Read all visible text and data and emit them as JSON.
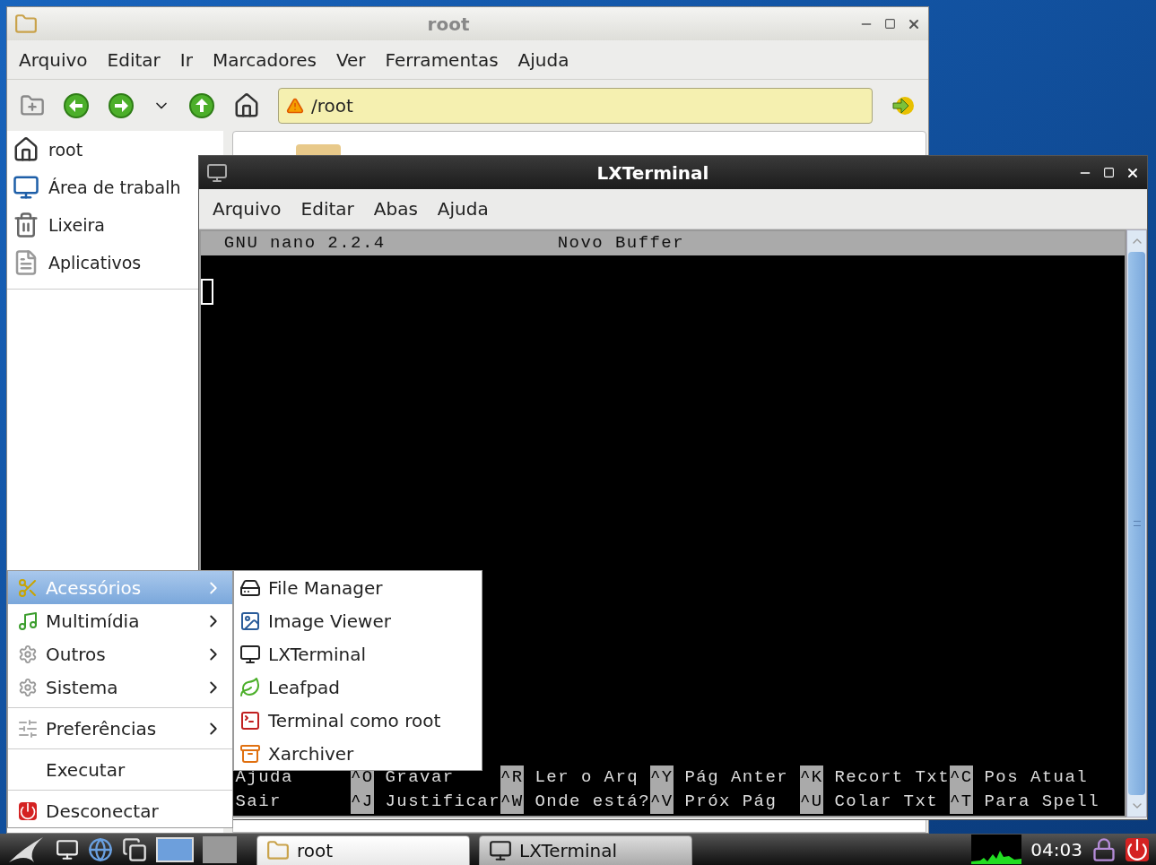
{
  "file_manager": {
    "title": "root",
    "menu": [
      "Arquivo",
      "Editar",
      "Ir",
      "Marcadores",
      "Ver",
      "Ferramentas",
      "Ajuda"
    ],
    "location": "/root",
    "sidebar": {
      "items": [
        {
          "label": "root"
        },
        {
          "label": "Área de trabalh"
        },
        {
          "label": "Lixeira"
        },
        {
          "label": "Aplicativos"
        }
      ]
    }
  },
  "terminal": {
    "title": "LXTerminal",
    "menu": [
      "Arquivo",
      "Editar",
      "Abas",
      "Ajuda"
    ],
    "nano": {
      "header_left": "GNU nano 2.2.4",
      "header_center": "Novo Buffer",
      "shortcut_rows": [
        [
          {
            "label": "Ajuda"
          },
          {
            "key": "^O",
            "label": "Gravar"
          },
          {
            "key": "^R",
            "label": "Ler o Arq"
          },
          {
            "key": "^Y",
            "label": "Pág Anter"
          },
          {
            "key": "^K",
            "label": "Recort Txt"
          },
          {
            "key": "^C",
            "label": "Pos Atual"
          }
        ],
        [
          {
            "label": "Sair"
          },
          {
            "key": "^J",
            "label": "Justificar"
          },
          {
            "key": "^W",
            "label": "Onde está?"
          },
          {
            "key": "^V",
            "label": "Próx Pág"
          },
          {
            "key": "^U",
            "label": "Colar Txt"
          },
          {
            "key": "^T",
            "label": "Para Spell"
          }
        ]
      ]
    }
  },
  "app_menu": {
    "items": [
      {
        "kind": "submenu",
        "label": "Acessórios",
        "selected": true
      },
      {
        "kind": "submenu",
        "label": "Multimídia",
        "selected": false
      },
      {
        "kind": "submenu",
        "label": "Outros",
        "selected": false
      },
      {
        "kind": "submenu",
        "label": "Sistema",
        "selected": false
      },
      {
        "kind": "separator"
      },
      {
        "kind": "submenu",
        "label": "Preferências",
        "selected": false
      },
      {
        "kind": "separator"
      },
      {
        "kind": "action",
        "label": "Executar",
        "selected": false
      },
      {
        "kind": "separator"
      },
      {
        "kind": "action",
        "label": "Desconectar",
        "selected": false
      }
    ],
    "submenu": [
      "File Manager",
      "Image Viewer",
      "LXTerminal",
      "Leafpad",
      "Terminal como root",
      "Xarchiver"
    ]
  },
  "taskbar": {
    "tasks": [
      {
        "label": "root",
        "selected": false
      },
      {
        "label": "LXTerminal",
        "selected": true
      }
    ],
    "clock": "04:03"
  }
}
